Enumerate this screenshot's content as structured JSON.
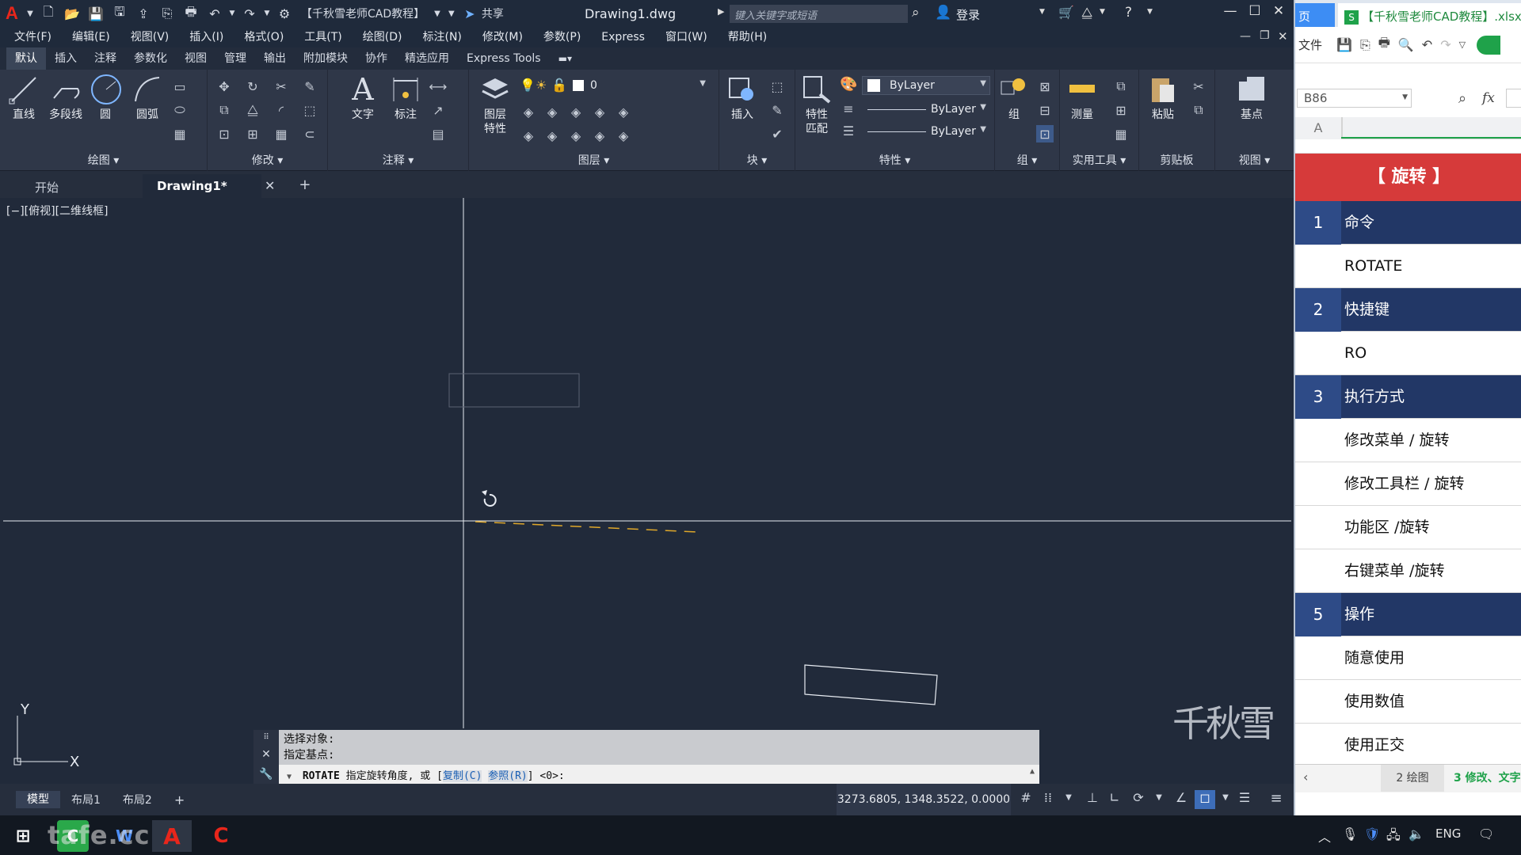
{
  "titlebar": {
    "app_logo": "A",
    "workspace": "【千秋雪老师CAD教程】",
    "share": "共享",
    "doc_title": "Drawing1.dwg",
    "search_placeholder": "键入关键字或短语",
    "login": "登录",
    "icons": [
      "new-icon",
      "open-icon",
      "save-icon",
      "saveas-icon",
      "plot-icon",
      "undo-icon",
      "redo-icon",
      "gear-icon",
      "share-icon",
      "search-icon",
      "user-icon",
      "cart-icon",
      "help-icon"
    ]
  },
  "menubar": [
    "文件(F)",
    "编辑(E)",
    "视图(V)",
    "插入(I)",
    "格式(O)",
    "工具(T)",
    "绘图(D)",
    "标注(N)",
    "修改(M)",
    "参数(P)",
    "Express",
    "窗口(W)",
    "帮助(H)"
  ],
  "ribbon_tabs": [
    "默认",
    "插入",
    "注释",
    "参数化",
    "视图",
    "管理",
    "输出",
    "附加模块",
    "协作",
    "精选应用",
    "Express Tools"
  ],
  "ribbon": {
    "draw": {
      "title": "绘图",
      "line": "直线",
      "polyline": "多段线",
      "circle": "圆",
      "arc": "圆弧"
    },
    "modify": {
      "title": "修改"
    },
    "annotation": {
      "title": "注释",
      "text": "文字",
      "dim": "标注"
    },
    "layers": {
      "title": "图层",
      "props": "图层\n特性",
      "layer_value": "0"
    },
    "block": {
      "title": "块",
      "insert": "插入"
    },
    "properties": {
      "title": "特性",
      "match": "特性\n匹配",
      "color": "ByLayer",
      "linetype": "ByLayer",
      "lineweight": "ByLayer"
    },
    "groups": {
      "title": "组",
      "group": "组"
    },
    "utilities": {
      "title": "实用工具",
      "measure": "测量"
    },
    "clipboard": {
      "title": "剪贴板",
      "paste": "粘贴"
    },
    "view": {
      "title": "视图",
      "base": "基点"
    }
  },
  "doctabs": {
    "start": "开始",
    "drawing": "Drawing1*"
  },
  "viewport_label": "[−][俯视][二维线框]",
  "command": {
    "history1": "选择对象:",
    "history2": "指定基点:",
    "prompt_cmd": "ROTATE",
    "prompt_text": "指定旋转角度, 或 [",
    "opt_copy": "复制(C)",
    "opt_ref": "参照(R)",
    "prompt_end": "] <0>:"
  },
  "layout_tabs": [
    "模型",
    "布局1",
    "布局2"
  ],
  "coords": "3273.6805, 1348.3522, 0.0000",
  "watermark": "千秋雪",
  "taskbar_watermark": "tafe.cc",
  "excel": {
    "tab_home": "页",
    "tab_file": "【千秋雪老师CAD教程】.xlsx",
    "file_menu": "文件",
    "namebox": "B86",
    "fx": "fx",
    "col_a": "A",
    "heading": "【 旋转 】",
    "rows": [
      {
        "num": "1",
        "text": "命令",
        "hdr": true
      },
      {
        "num": "",
        "text": "ROTATE",
        "hdr": false
      },
      {
        "num": "2",
        "text": "快捷键",
        "hdr": true
      },
      {
        "num": "",
        "text": "RO",
        "hdr": false
      },
      {
        "num": "3",
        "text": "执行方式",
        "hdr": true
      },
      {
        "num": "",
        "text": "修改菜单 / 旋转",
        "hdr": false
      },
      {
        "num": "",
        "text": "修改工具栏 / 旋转",
        "hdr": false
      },
      {
        "num": "",
        "text": "功能区 /旋转",
        "hdr": false
      },
      {
        "num": "",
        "text": "右键菜单 /旋转",
        "hdr": false
      },
      {
        "num": "5",
        "text": "操作",
        "hdr": true
      },
      {
        "num": "",
        "text": "随意使用",
        "hdr": false
      },
      {
        "num": "",
        "text": "使用数值",
        "hdr": false
      },
      {
        "num": "",
        "text": "使用正交",
        "hdr": false
      }
    ],
    "sheet1": "2 绘图",
    "sheet2": "3 修改、文字"
  },
  "tray": {
    "lang": "ENG"
  },
  "colors": {
    "cad_bg": "#212a3a",
    "excel_header": "#223766",
    "excel_title": "#d63a3a",
    "accent": "#3d8df4"
  }
}
